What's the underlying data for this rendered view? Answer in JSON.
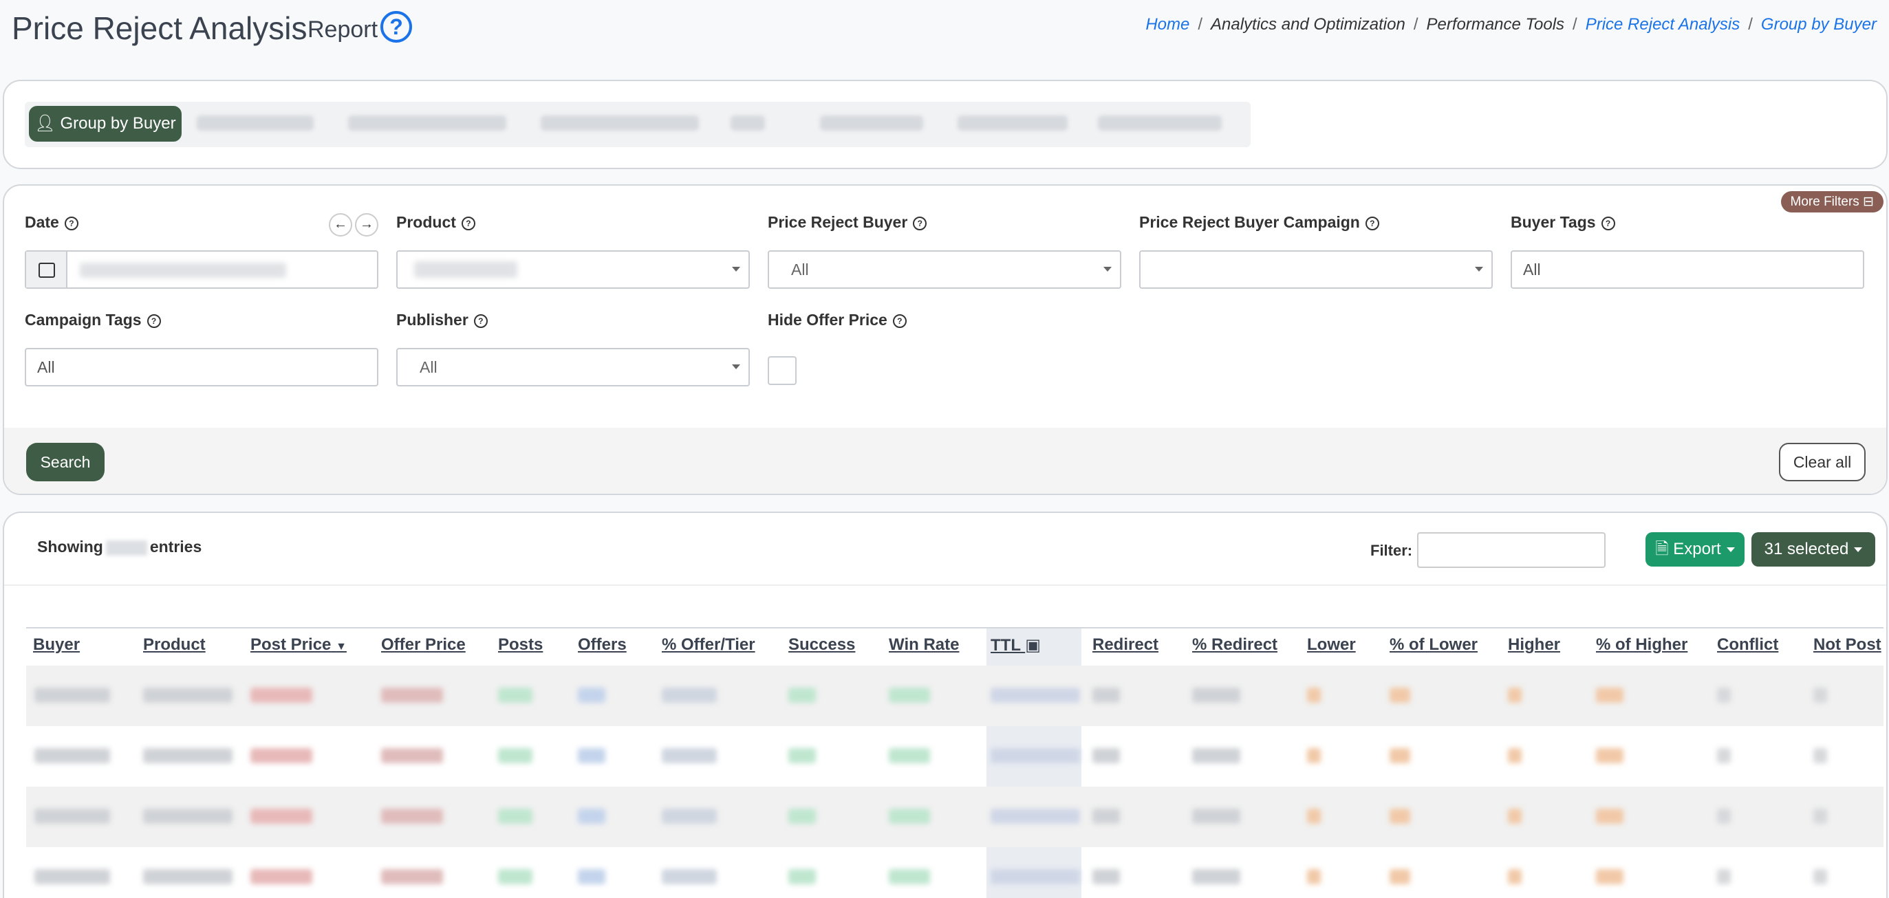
{
  "header": {
    "title": "Price Reject Analysis",
    "subtitle": "Report",
    "help_glyph": "?",
    "breadcrumbs": [
      {
        "label": "Home",
        "link": true
      },
      {
        "label": "Analytics and Optimization",
        "link": false
      },
      {
        "label": "Performance Tools",
        "link": false
      },
      {
        "label": "Price Reject Analysis",
        "link": true
      },
      {
        "label": "Group by Buyer",
        "link": true
      }
    ],
    "separator": "/"
  },
  "tabs": {
    "active_label": "Group by Buyer",
    "active_icon": "user-icon"
  },
  "filters": {
    "more_filters_label": "More Filters",
    "date_label": "Date",
    "product_label": "Product",
    "price_reject_buyer_label": "Price Reject Buyer",
    "price_reject_buyer_value": "All",
    "price_reject_buyer_campaign_label": "Price Reject Buyer Campaign",
    "price_reject_buyer_campaign_value": "",
    "buyer_tags_label": "Buyer Tags",
    "buyer_tags_value": "All",
    "campaign_tags_label": "Campaign Tags",
    "campaign_tags_value": "All",
    "publisher_label": "Publisher",
    "publisher_value": "All",
    "hide_offer_price_label": "Hide Offer Price",
    "hide_offer_price_checked": false,
    "prev_arrow": "←",
    "next_arrow": "→",
    "search_label": "Search",
    "clear_label": "Clear all"
  },
  "results": {
    "showing_prefix": "Showing",
    "showing_suffix": "entries",
    "filter_label": "Filter:",
    "filter_value": "",
    "export_label": "Export",
    "selected_label": "31 selected",
    "columns": [
      "Buyer",
      "Product",
      "Post Price",
      "Offer Price",
      "Posts",
      "Offers",
      "% Offer/Tier",
      "Success",
      "Win Rate",
      "TTL",
      "Redirect",
      "% Redirect",
      "Lower",
      "% of Lower",
      "Higher",
      "% of Higher",
      "Conflict",
      "Not Post"
    ],
    "sort_column": "Post Price",
    "sort_direction": "descending"
  },
  "colors": {
    "primary_green": "#3f5c46",
    "export_green": "#1c9a6a",
    "link_blue": "#1a73e8",
    "more_filters_brown": "#8a5e55"
  }
}
